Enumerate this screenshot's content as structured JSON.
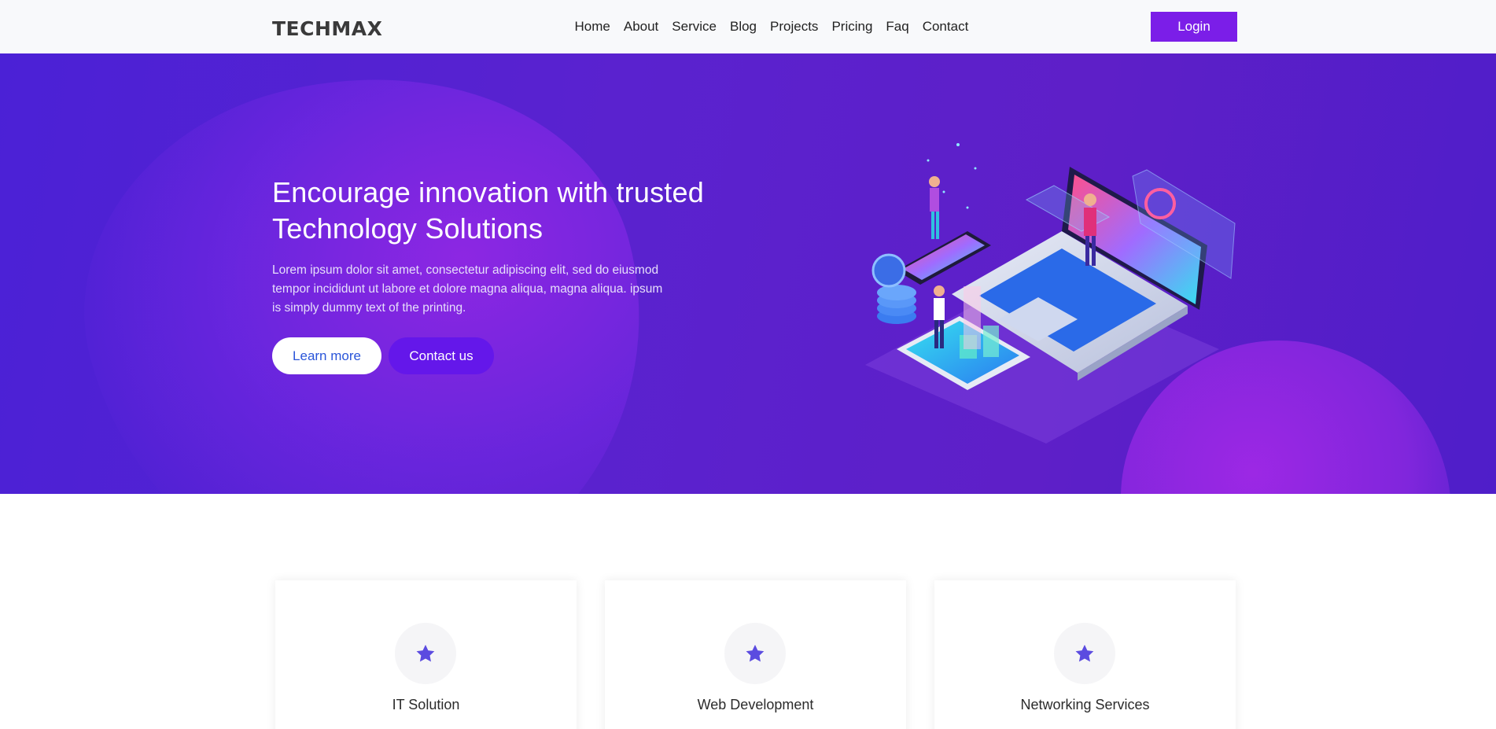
{
  "header": {
    "logo": "TECHMAX",
    "nav": [
      "Home",
      "About",
      "Service",
      "Blog",
      "Projects",
      "Pricing",
      "Faq",
      "Contact"
    ],
    "login_label": "Login"
  },
  "hero": {
    "title": "Encourage innovation with trusted Technology Solutions",
    "text": "Lorem ipsum dolor sit amet, consectetur adipiscing elit, sed do eiusmod tempor incididunt ut labore et dolore magna aliqua, magna aliqua. ipsum is simply dummy text of the printing.",
    "learn_more": "Learn more",
    "contact_us": "Contact us"
  },
  "services": [
    {
      "title": "IT Solution",
      "icon": "star-icon"
    },
    {
      "title": "Web Development",
      "icon": "star-icon"
    },
    {
      "title": "Networking Services",
      "icon": "star-icon"
    }
  ],
  "colors": {
    "accent": "#7b1ee8",
    "hero_bg": "#5a22cf",
    "star": "#5b4be0"
  }
}
